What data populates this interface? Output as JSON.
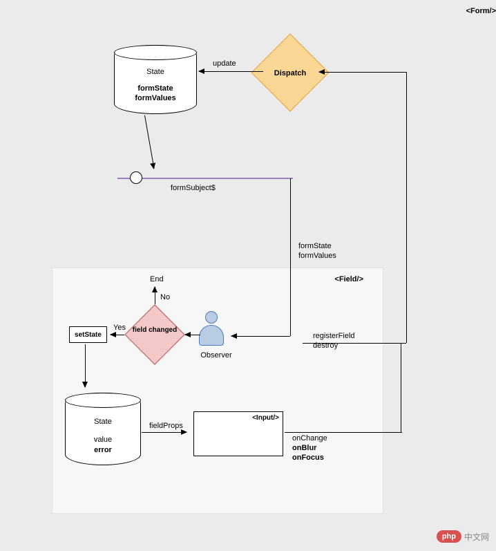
{
  "form_tag": "<Form/>",
  "state_top": {
    "title": "State",
    "line1": "formState",
    "line2": "formValues"
  },
  "dispatch": "Dispatch",
  "update_label": "update",
  "subject_label": "formSubject$",
  "flow_labels": {
    "formState": "formState",
    "formValues": "formValues"
  },
  "field_tag": "<Field/>",
  "end_label": "End",
  "no_label": "No",
  "yes_label": "Yes",
  "field_changed": "field changed",
  "observer": "Observer",
  "setstate": "setState",
  "register_label": "registerField",
  "destroy_label": "destroy",
  "state_bottom": {
    "title": "State",
    "line1": "value",
    "line2": "error"
  },
  "field_props": "fieldProps",
  "input_tag": "<Input/>",
  "events": {
    "onChange": "onChange",
    "onBlur": "onBlur",
    "onFocus": "onFocus"
  },
  "watermark": {
    "badge": "php",
    "text": "中文网"
  }
}
